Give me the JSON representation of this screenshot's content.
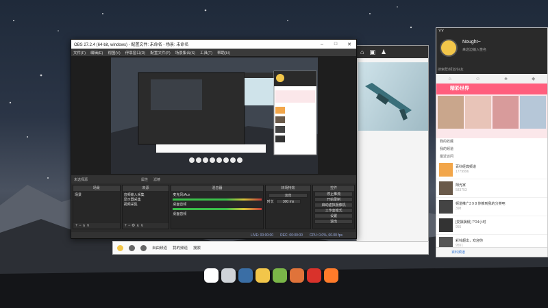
{
  "obs": {
    "title": "OBS 27.2.4 (64-bit, windows) - 配置文件: 未命名 - 场景: 未命名",
    "menu": [
      "文件(F)",
      "编辑(E)",
      "视图(V)",
      "停靠窗口(D)",
      "配置文件(P)",
      "场景集合(S)",
      "工具(T)",
      "帮助(H)"
    ],
    "scene_info": {
      "label": "未选择源",
      "props": "属性",
      "filters": "滤镜"
    },
    "docks": {
      "scenes": {
        "title": "场景",
        "items": [
          "场景"
        ]
      },
      "sources": {
        "title": "来源",
        "items": [
          "音频输入采集",
          "显示器采集",
          "视频采集"
        ]
      },
      "mixer": {
        "title": "混音器",
        "ch1": "麦克风/Aux",
        "ch2": "桌面音频",
        "ch3": "桌面音频"
      },
      "transitions": {
        "title": "转场特效",
        "fade": "淡出",
        "duration_label": "时长",
        "duration": "300 ms"
      },
      "controls": {
        "title": "控件",
        "buttons": [
          "停止推流",
          "开始录制",
          "启动虚拟摄像机",
          "工作室模式",
          "设置",
          "退出"
        ]
      }
    },
    "status": {
      "live": "LIVE: 00:00:00",
      "rec": "REC: 00:00:00",
      "cpu": "CPU: 0.0%, 60.00 fps"
    }
  },
  "yy": {
    "logo": "YY",
    "username": "Nought~",
    "signature": "来这边输入签名",
    "search_hint": "搜索群/频道/好友",
    "promo_title": "精彩世界",
    "sections": {
      "my_favorites": "我的收藏",
      "my_channels": "我的频道",
      "recent": "最近访问"
    },
    "items": [
      {
        "title": "百科经典频道",
        "sub": "1779996"
      },
      {
        "title": "阳光家",
        "sub": "583753"
      },
      {
        "title": "频道推广3 9 8 你推到我的分类吧",
        "sub": "398"
      },
      {
        "title": "[爱飘飘频] 7*24小时",
        "sub": "955"
      },
      {
        "title": "彩铃超出，欢迎你",
        "sub": "9551"
      }
    ],
    "footer": "百科频道"
  },
  "bar2": {
    "items": [
      "自由频道",
      "我的频道",
      "搜索"
    ]
  },
  "colors": {
    "obs_bg": "#2b2b2b",
    "yy_accent": "#ff5e7d",
    "yy_avatar": "#f2c64a"
  }
}
